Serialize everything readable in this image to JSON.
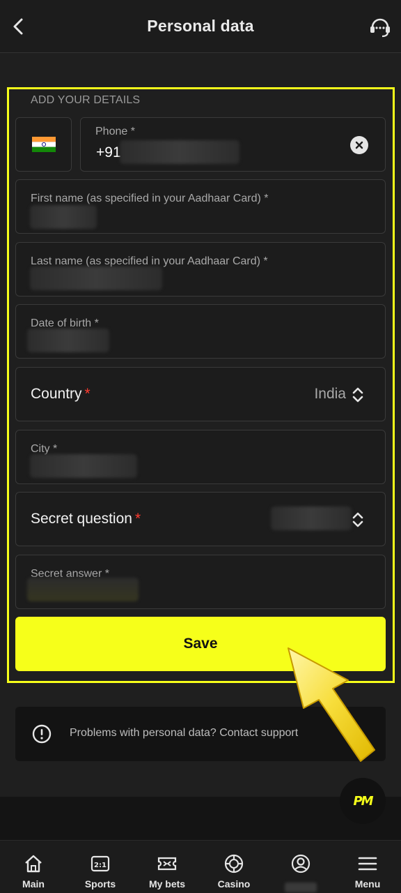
{
  "header": {
    "title": "Personal data",
    "back_icon": "chevron-left-icon",
    "support_icon": "headset-icon"
  },
  "form": {
    "section_label": "ADD YOUR DETAILS",
    "phone": {
      "label": "Phone *",
      "prefix": "+91",
      "country_flag": "india-flag-icon",
      "clear_icon": "close-icon"
    },
    "first_name": {
      "label": "First name (as specified in your Aadhaar Card) *"
    },
    "last_name": {
      "label": "Last name (as specified in your Aadhaar Card) *"
    },
    "dob": {
      "label": "Date of birth *"
    },
    "country": {
      "label": "Country",
      "required_mark": "*",
      "value": "India"
    },
    "city": {
      "label": "City *"
    },
    "secret_question": {
      "label": "Secret question",
      "required_mark": "*"
    },
    "secret_answer": {
      "label": "Secret answer *"
    },
    "save_label": "Save"
  },
  "support": {
    "text": "Problems with personal data? Contact support",
    "icon": "info-icon"
  },
  "fab": {
    "logo_text": "PM"
  },
  "nav": {
    "items": [
      {
        "label": "Main",
        "icon": "home-icon"
      },
      {
        "label": "Sports",
        "icon": "scoreboard-icon"
      },
      {
        "label": "My bets",
        "icon": "ticket-icon"
      },
      {
        "label": "Casino",
        "icon": "casino-chip-icon"
      },
      {
        "label": "",
        "icon": "user-icon"
      },
      {
        "label": "Menu",
        "icon": "hamburger-icon"
      }
    ]
  },
  "colors": {
    "accent": "#f6ff1a",
    "required": "#ff3b30",
    "background": "#1f1f1f"
  }
}
